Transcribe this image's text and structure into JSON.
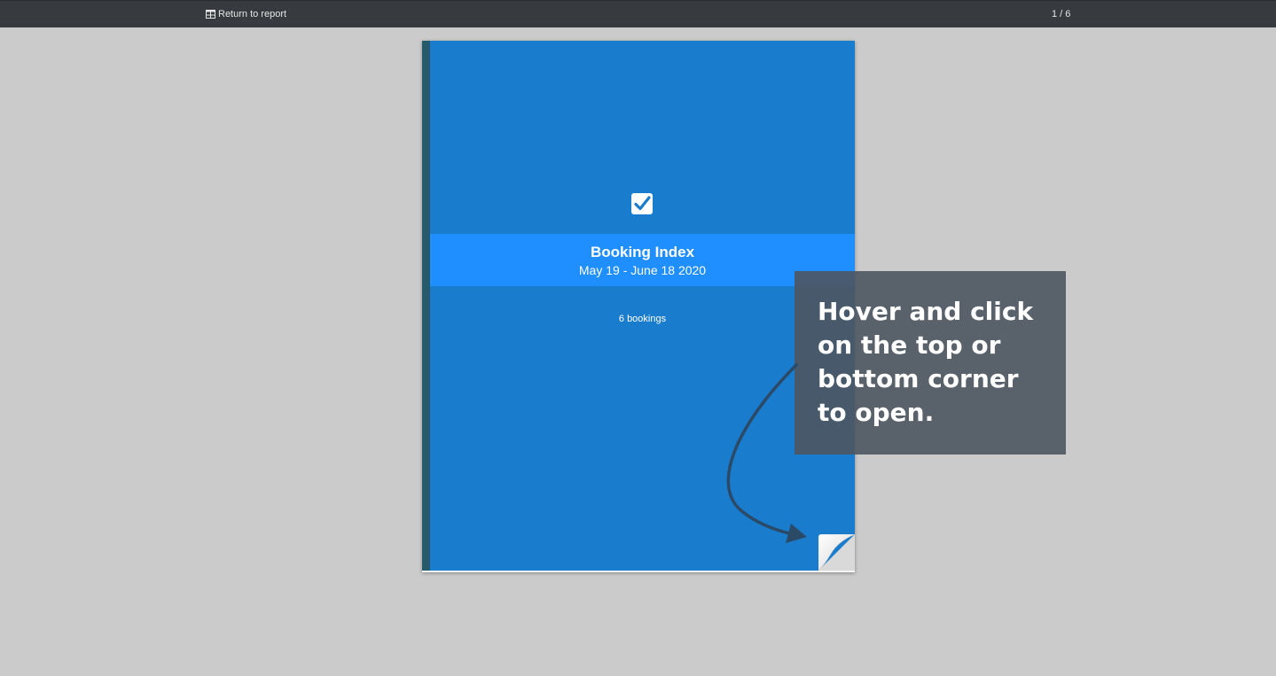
{
  "toolbar": {
    "return_label": "Return to report",
    "return_icon": "table-icon",
    "page_indicator": "1 / 6"
  },
  "book": {
    "cover_icon": "checkbox-checked-icon",
    "title": "Booking Index",
    "date_range": "May 19 - June 18 2020",
    "bookings_count": "6 bookings",
    "cover_color": "#1a7ccc",
    "band_color": "#1f8fff",
    "spine_color": "#265a6a",
    "corner_icon": "page-curl-icon"
  },
  "hint": {
    "text": "Hover and click on the top or bottom corner to open.",
    "arrow_icon": "curved-arrow-icon"
  }
}
